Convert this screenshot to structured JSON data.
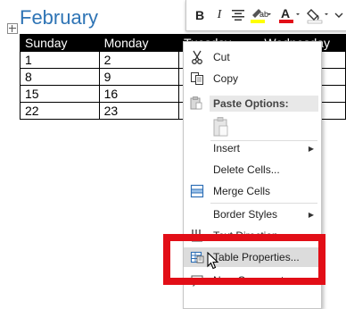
{
  "document": {
    "month_title": "February",
    "table": {
      "headers": [
        "Sunday",
        "Monday",
        "Tuesday",
        "Wednesday"
      ],
      "rows": [
        [
          "1",
          "2",
          "",
          ""
        ],
        [
          "8",
          "9",
          "",
          ""
        ],
        [
          "15",
          "16",
          "",
          ""
        ],
        [
          "22",
          "23",
          "",
          ""
        ]
      ]
    }
  },
  "mini_toolbar": {
    "bold": "B",
    "italic": "I",
    "font_color_letter": "A"
  },
  "context_menu": {
    "cut": "Cut",
    "copy": "Copy",
    "paste_options": "Paste Options:",
    "insert": "Insert",
    "delete_cells": "Delete Cells...",
    "merge_cells": "Merge Cells",
    "border_styles": "Border Styles",
    "text_direction": "Text Direction...",
    "table_properties": "Table Properties...",
    "new_comment": "New Comment"
  },
  "colors": {
    "title_blue": "#2e74b5",
    "highlight_yellow": "#ffff00",
    "font_red": "#e20e17",
    "callout_red": "#e20e17"
  }
}
